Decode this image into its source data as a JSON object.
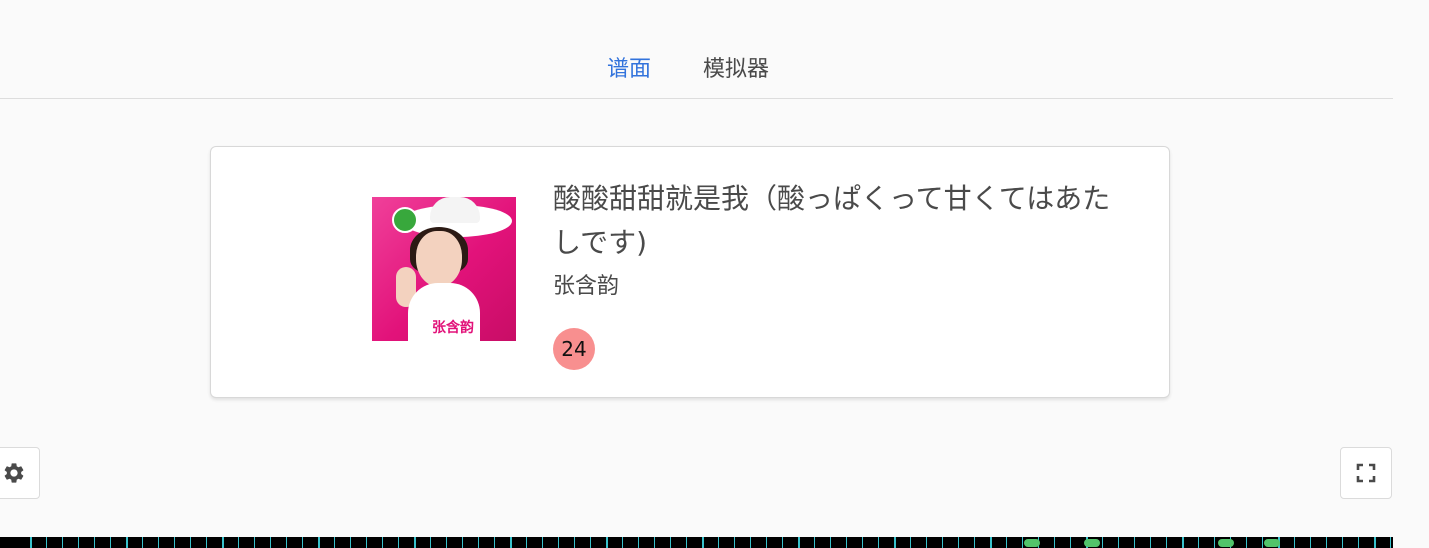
{
  "tabs": [
    {
      "label": "谱面",
      "active": true
    },
    {
      "label": "模拟器",
      "active": false
    }
  ],
  "song": {
    "title": "酸酸甜甜就是我（酸っぱくって甘くてはあたしです)",
    "artist": "张含韵",
    "level": "24",
    "cover_text": "张含韵"
  },
  "toolbar": {
    "settings_icon": "gear-icon",
    "fullscreen_icon": "fullscreen-icon"
  },
  "colors": {
    "accent": "#3273dc",
    "level_badge": "#f88f8f",
    "cover_bg": "#e2127a",
    "chart_bg": "#000000",
    "chart_line": "#38c2cc",
    "note": "#52c46a"
  }
}
